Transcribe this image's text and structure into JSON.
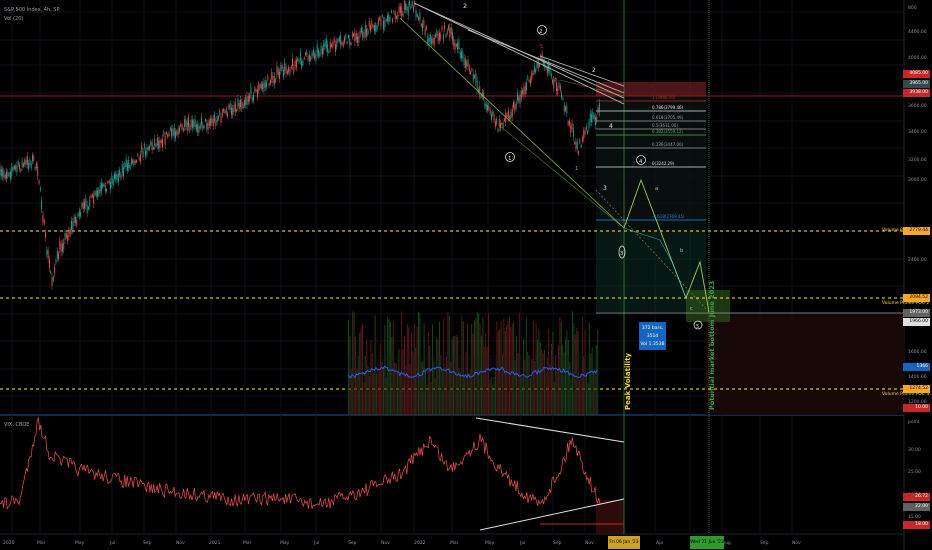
{
  "header": {
    "symbol_line": "S&P 500 Index, 4h, SP",
    "indicator_line": "Vol (20)"
  },
  "price_axis": {
    "labels": [
      "800",
      "4400.00",
      "4000.00",
      "3600.00",
      "3400.00",
      "3200.00",
      "3000.00",
      "2600.00",
      "2400.00",
      "2000.00",
      "1800.00",
      "1600.00",
      "1400.00",
      "1200.00"
    ],
    "badges": {
      "b1": "4085.00",
      "b2": "3965.00",
      "b3": "3938.00",
      "b4": "2779.44",
      "b5": "2094.52",
      "b6": "1973.00",
      "b7": "1966.00",
      "b8": "1366",
      "b9": "1274.52",
      "b10": "10.00"
    }
  },
  "volume_profile_labels": {
    "poc1": "Volume Profile POC 1",
    "poc2": "Volume Profile POC 2",
    "poc3": "Volume Profile POC 3"
  },
  "fib_labels": [
    "1 (3966.00)",
    "0.786(3799.46)",
    "0.618(3705.49)",
    "0.5(3631.00)",
    "0.382(3559.12)",
    "0.236(3447.00)",
    "0(3242.29)",
    "-0.618(2769.45)"
  ],
  "wave_labels": {
    "w2_top": "2",
    "w2_circle": "2",
    "w1_circle": "1",
    "w3_circle": "3",
    "w4_circle": "4",
    "w5_circle": "5",
    "sub_a": "a",
    "sub_b": "b",
    "sub_c": "c",
    "sub_1": "1",
    "sub_2": "2",
    "sub_3": "3",
    "sub_4": "4",
    "sub_5": "5"
  },
  "annotations": {
    "peak_volatility": "Peak Volatility",
    "potential_bottom": "Potential market bottom June 2023",
    "info_line1": "372 bars, 351d",
    "info_line2": "Vol 1.353B"
  },
  "vix_panel": {
    "title": "VIX, CBOE",
    "right_label": "point",
    "axis_labels": [
      "30.00",
      "25.00",
      "20.00",
      "15.00"
    ],
    "badges": {
      "v1": "26.72",
      "v2": "22.00",
      "v3": "18.00"
    }
  },
  "time_axis": {
    "labels": [
      "2020",
      "Mar",
      "May",
      "Jul",
      "Sep",
      "Nov",
      "2021",
      "Mar",
      "May",
      "Jul",
      "Sep",
      "Nov",
      "2022",
      "Mar",
      "May",
      "Jul",
      "Sep",
      "Nov",
      "Apr",
      "Jun",
      "Aug",
      "Sep",
      "Nov"
    ],
    "date_box_1": "Fri 06 Jan '23 14:30",
    "date_box_2": "Wed 21 Jun '23 16:30"
  },
  "colors": {
    "background": "#000000",
    "candle_up": "#26a69a",
    "candle_down": "#ef5350",
    "poc_line": "#ffeb3b",
    "volume_ma": "#2962ff",
    "projection_green": "#43a047",
    "badge_red": "#f44336",
    "badge_blue": "#1565c0"
  }
}
